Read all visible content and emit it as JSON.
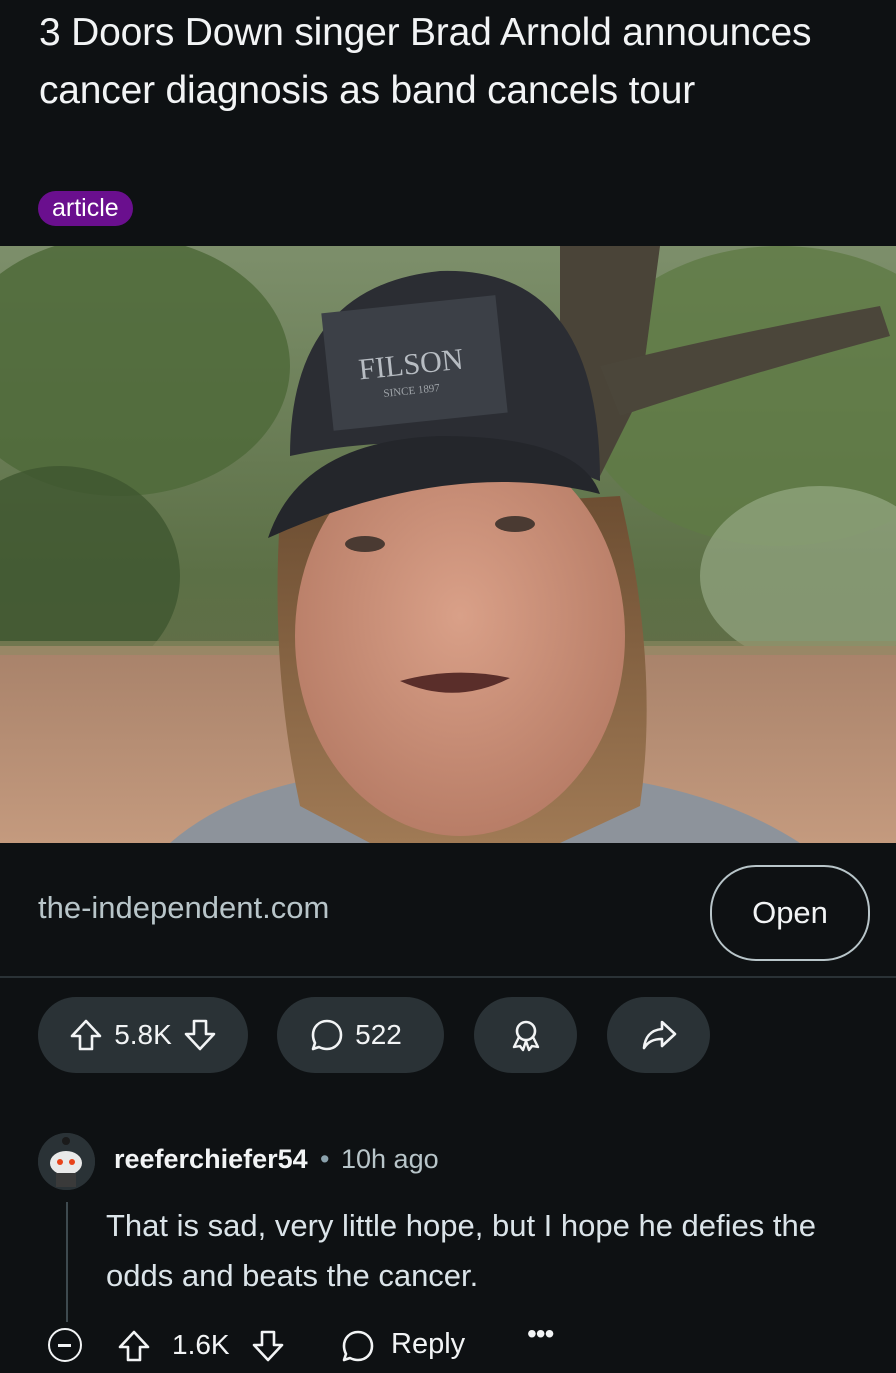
{
  "post": {
    "title": "3 Doors Down singer Brad Arnold announces cancer diagnosis as band cancels tour",
    "flair": "article",
    "flair_color": "#6a0f8e",
    "image": {
      "description_icon": "person-photo",
      "cap_text": "FILSON",
      "cap_subtext": "SINCE 1897"
    },
    "link": {
      "domain": "the-independent.com",
      "open_label": "Open"
    },
    "actions": {
      "score": "5.8K",
      "comments": "522",
      "award_icon": "award-icon",
      "share_icon": "share-icon"
    }
  },
  "comment": {
    "username": "reeferchiefer54",
    "separator": "•",
    "time": "10h ago",
    "body": "That is sad, very little hope, but I hope he defies the odds and beats the cancer.",
    "score": "1.6K",
    "reply_label": "Reply",
    "more_label": "•••"
  },
  "colors": {
    "background": "#0e1113",
    "pill": "#2a3236",
    "text": "#f2f4f5",
    "muted": "#b8c5c9"
  }
}
